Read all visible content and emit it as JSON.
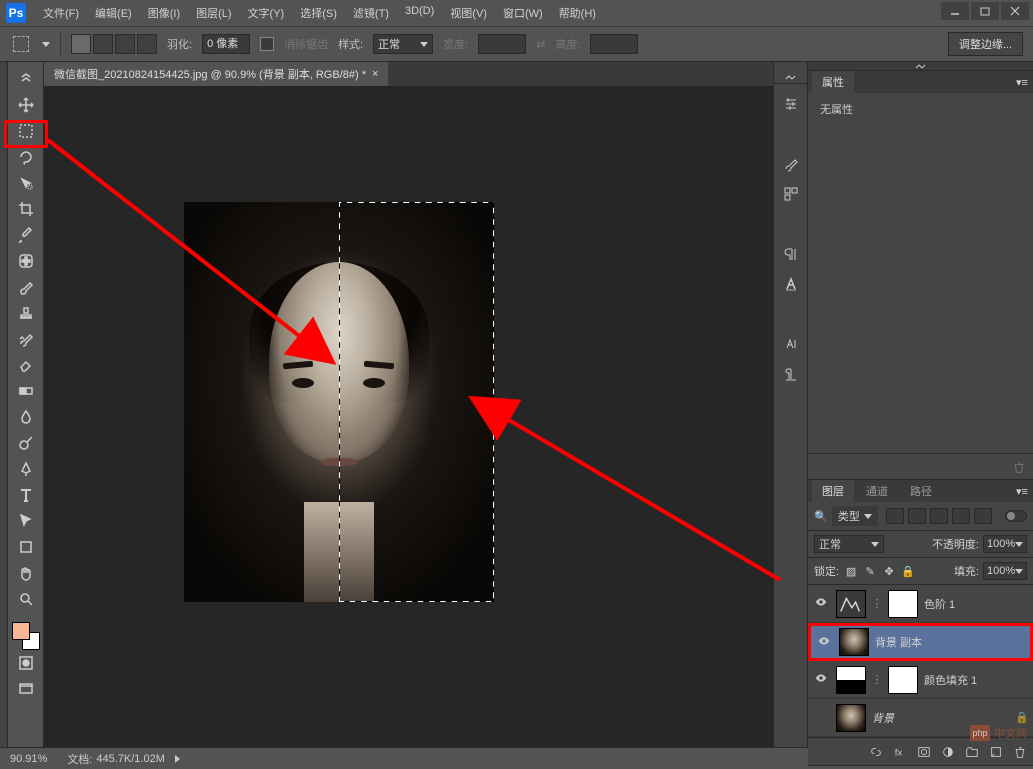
{
  "app": {
    "logo": "Ps"
  },
  "menu": [
    "文件(F)",
    "编辑(E)",
    "图像(I)",
    "图层(L)",
    "文字(Y)",
    "选择(S)",
    "滤镜(T)",
    "3D(D)",
    "视图(V)",
    "窗口(W)",
    "帮助(H)"
  ],
  "options": {
    "feather_label": "羽化:",
    "feather_value": "0 像素",
    "antialias_label": "消除锯齿",
    "style_label": "样式:",
    "style_value": "正常",
    "width_label": "宽度:",
    "height_label": "高度:",
    "refine_label": "调整边缘..."
  },
  "document": {
    "tab_title": "微信截图_20210824154425.jpg @ 90.9% (背景 副本, RGB/8#) *"
  },
  "panels": {
    "properties": {
      "tab": "属性",
      "body": "无属性"
    },
    "layers": {
      "tabs": [
        "图层",
        "通道",
        "路径"
      ],
      "filter_label": "类型",
      "blend_mode": "正常",
      "opacity_label": "不透明度:",
      "opacity_value": "100%",
      "lock_label": "锁定:",
      "fill_label": "填充:",
      "fill_value": "100%",
      "items": [
        {
          "name": "色阶 1",
          "type": "adjustment"
        },
        {
          "name": "背景 副本",
          "type": "image",
          "selected": true
        },
        {
          "name": "颜色填充 1",
          "type": "fill"
        },
        {
          "name": "背景",
          "type": "locked",
          "italic": true
        }
      ]
    }
  },
  "status": {
    "zoom": "90.91%",
    "doc_label": "文档:",
    "doc_value": "445.7K/1.02M"
  },
  "watermark": {
    "text": "中文网",
    "prefix": "php"
  }
}
